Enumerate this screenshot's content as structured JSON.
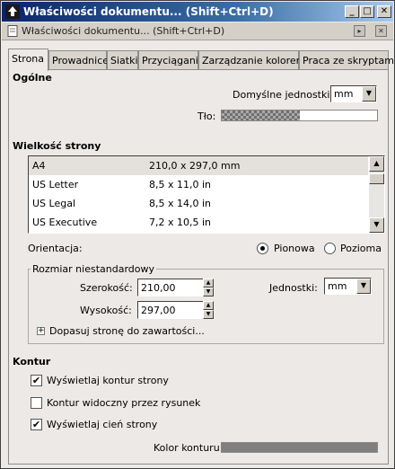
{
  "window": {
    "title": "Właściwości dokumentu... (Shift+Ctrl+D)",
    "min_label": "_",
    "max_label": "□",
    "close_label": "✕"
  },
  "dock": {
    "title": "Właściwości dokumentu... (Shift+Ctrl+D)",
    "btn_a": "▸",
    "btn_b": "✕"
  },
  "tabs": [
    {
      "label": "Strona"
    },
    {
      "label": "Prowadnice"
    },
    {
      "label": "Siatki"
    },
    {
      "label": "Przyciąganie"
    },
    {
      "label": "Zarządzanie kolorem"
    },
    {
      "label": "Praca ze skryptami"
    }
  ],
  "general": {
    "heading": "Ogólne",
    "units_label": "Domyślne jednostki:",
    "units_value": "mm",
    "background_label": "Tło:"
  },
  "page_size": {
    "heading": "Wielkość strony",
    "rows": [
      {
        "name": "A4",
        "size": "210,0 x 297,0 mm"
      },
      {
        "name": "US Letter",
        "size": "8,5 x 11,0 in"
      },
      {
        "name": "US Legal",
        "size": "8,5 x 14,0 in"
      },
      {
        "name": "US Executive",
        "size": "7,2 x 10,5 in"
      }
    ],
    "orientation_label": "Orientacja:",
    "portrait_label": "Pionowa",
    "landscape_label": "Pozioma"
  },
  "custom_size": {
    "legend": "Rozmiar niestandardowy",
    "width_label": "Szerokość:",
    "width_value": "210,00",
    "height_label": "Wysokość:",
    "height_value": "297,00",
    "units_label": "Jednostki:",
    "units_value": "mm",
    "fit_label": "Dopasuj stronę do zawartości..."
  },
  "border": {
    "heading": "Kontur",
    "show_border": "Wyświetlaj kontur strony",
    "border_on_top": "Kontur widoczny przez rysunek",
    "show_shadow": "Wyświetlaj cień strony",
    "border_color_label": "Kolor konturu:",
    "border_color": "#7f7f7f"
  },
  "glyphs": {
    "check": "✔",
    "arrow_down": "▼",
    "arrow_up": "▲",
    "plus": "+"
  }
}
